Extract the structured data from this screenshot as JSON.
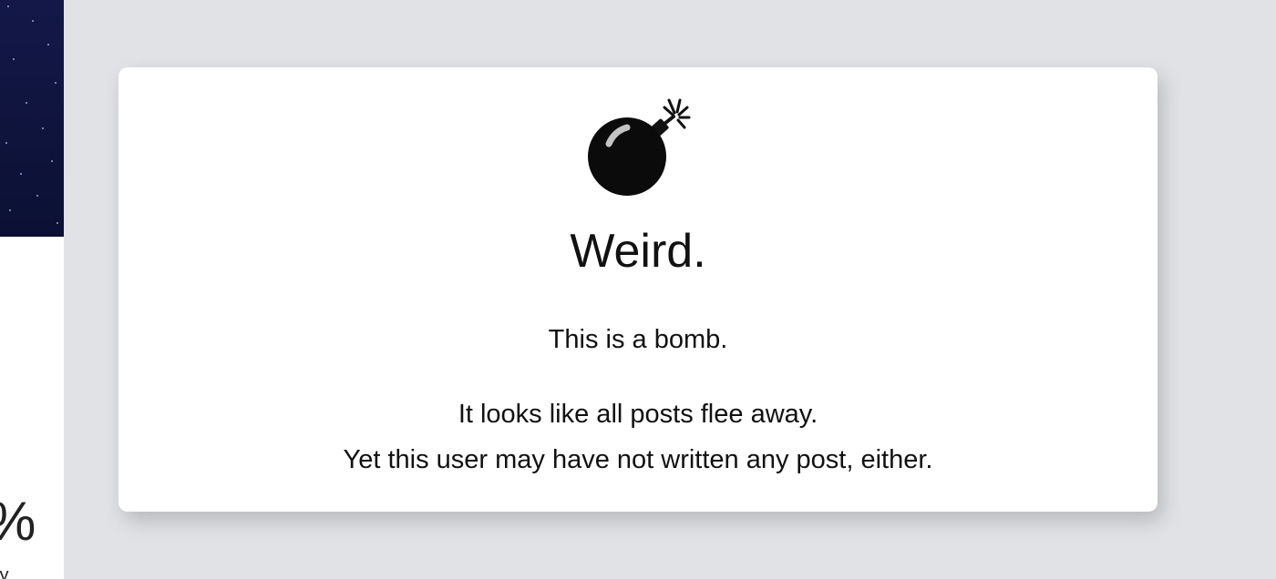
{
  "sidebar": {
    "stat_value": "%",
    "stat_label": "ty"
  },
  "empty_state": {
    "icon": "bomb-icon",
    "title": "Weird.",
    "line1": "This is a bomb.",
    "line2": "It looks like all posts flee away.",
    "line3": "Yet this user may have not written any post, either."
  },
  "colors": {
    "page_background": "#e1e2e6",
    "card_background": "#ffffff",
    "text": "#111111",
    "starfield": "#0f143d"
  }
}
